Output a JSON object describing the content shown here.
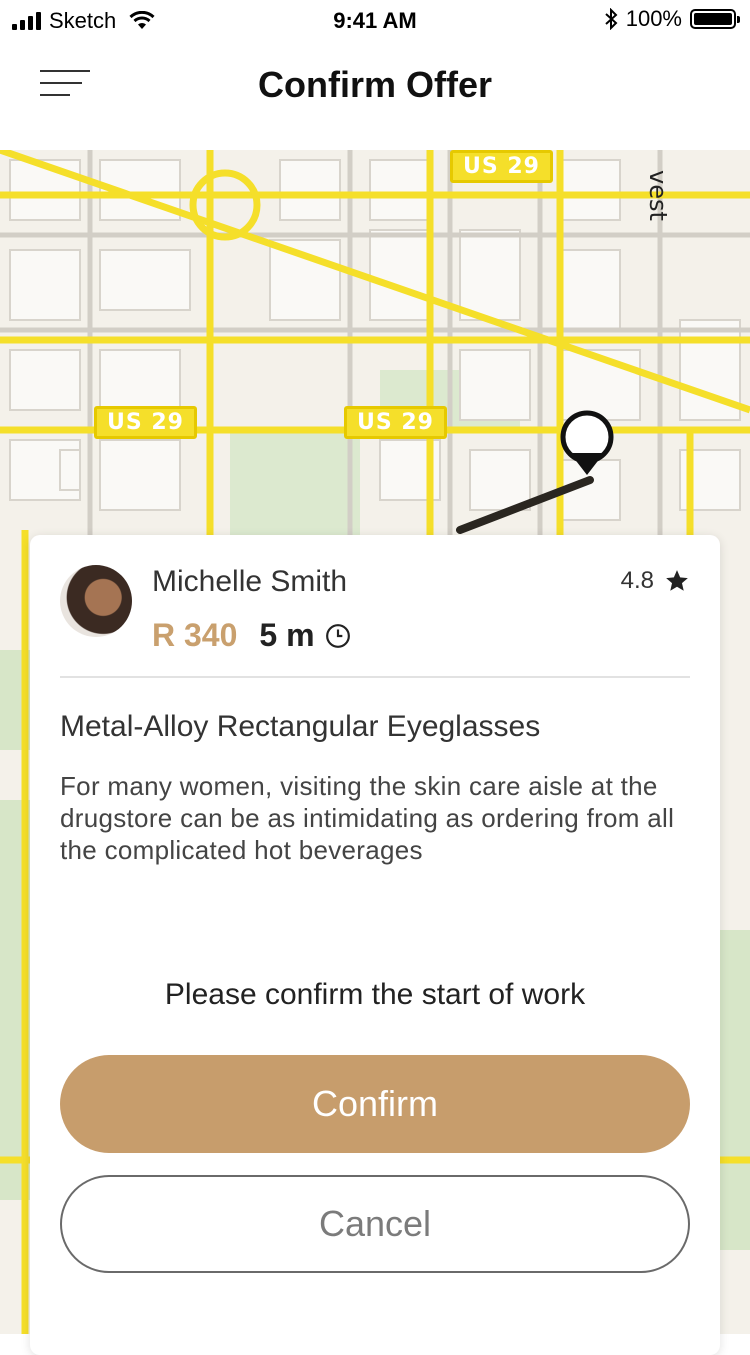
{
  "status_bar": {
    "carrier": "Sketch",
    "time": "9:41 AM",
    "battery": "100%"
  },
  "header": {
    "title": "Confirm Offer",
    "menu_icon": "menu-icon"
  },
  "map": {
    "route_labels": [
      "US 29",
      "US 29",
      "US 29"
    ],
    "street_fragment": "vest"
  },
  "offer": {
    "user_name": "Michelle Smith",
    "rating": "4.8",
    "price": "R 340",
    "duration": "5 m",
    "item_title": "Metal-Alloy Rectangular Eyeglasses",
    "item_description": "For many women, visiting the skin care aisle at the drugstore can be as intimidating as ordering from all the complicated hot beverages",
    "prompt": "Please confirm the start of work",
    "confirm_label": "Confirm",
    "cancel_label": "Cancel"
  },
  "colors": {
    "accent": "#c79d6c",
    "road": "#f5df2a",
    "route": "#2a2620"
  }
}
